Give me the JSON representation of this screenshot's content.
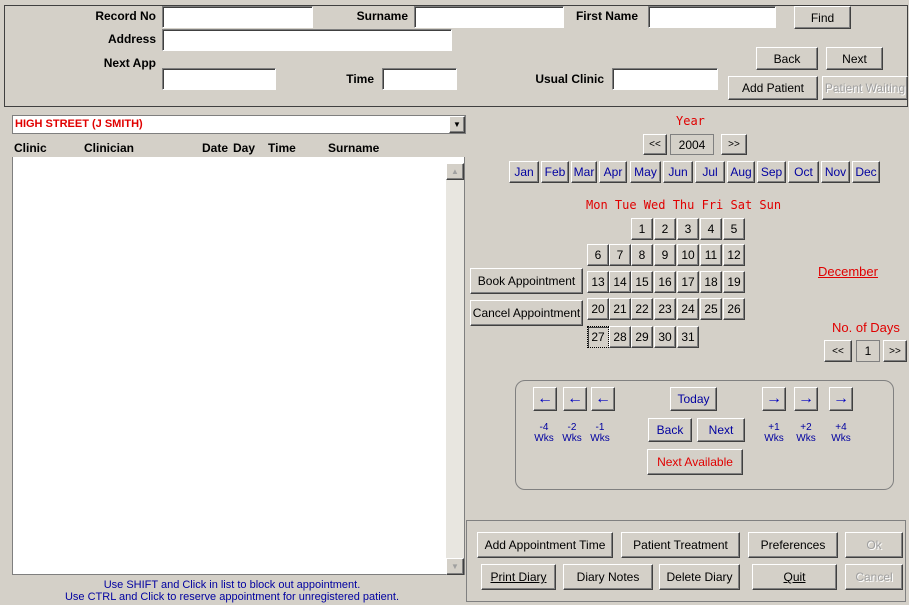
{
  "search": {
    "record_no_label": "Record No",
    "surname_label": "Surname",
    "first_name_label": "First Name",
    "address_label": "Address",
    "next_app_label": "Next App",
    "time_label": "Time",
    "usual_clinic_label": "Usual Clinic",
    "record_no_value": "",
    "surname_value": "",
    "first_name_value": "",
    "address_value": "",
    "next_app_value": "",
    "time_value": "",
    "usual_clinic_value": ""
  },
  "top_buttons": {
    "find": "Find",
    "back": "Back",
    "next": "Next",
    "add_patient": "Add Patient",
    "patient_waiting": "Patient Waiting"
  },
  "clinic": {
    "selected": "HIGH STREET (J SMITH)",
    "columns": [
      "Clinic",
      "Clinician",
      "Date",
      "Day",
      "Time",
      "Surname"
    ]
  },
  "hints": {
    "line1": "Use SHIFT and Click in list to block out appointment.",
    "line2": "Use CTRL and Click to reserve appointment for unregistered patient."
  },
  "calendar": {
    "year_label": "Year",
    "year": "2004",
    "prev_year": "<<",
    "next_year": ">>",
    "months": [
      "Jan",
      "Feb",
      "Mar",
      "Apr",
      "May",
      "Jun",
      "Jul",
      "Aug",
      "Sep",
      "Oct",
      "Nov",
      "Dec"
    ],
    "weekday_header": "Mon Tue Wed Thu Fri Sat Sun",
    "month_name": "December",
    "weeks": [
      [
        "",
        "",
        "1",
        "2",
        "3",
        "4",
        "5"
      ],
      [
        "6",
        "7",
        "8",
        "9",
        "10",
        "11",
        "12"
      ],
      [
        "13",
        "14",
        "15",
        "16",
        "17",
        "18",
        "19"
      ],
      [
        "20",
        "21",
        "22",
        "23",
        "24",
        "25",
        "26"
      ],
      [
        "27",
        "28",
        "29",
        "30",
        "31",
        "",
        ""
      ]
    ],
    "selected_day": "27",
    "no_of_days_label": "No. of Days",
    "no_of_days": "1",
    "days_prev": "<<",
    "days_next": ">>"
  },
  "appointment_buttons": {
    "book": "Book Appointment",
    "cancel": "Cancel Appointment"
  },
  "nav": {
    "arrow_left": "←",
    "arrow_right": "→",
    "minus_labels": [
      "-4",
      "-2",
      "-1"
    ],
    "plus_labels": [
      "+1",
      "+2",
      "+4"
    ],
    "wks": "Wks",
    "today": "Today",
    "back": "Back",
    "next": "Next",
    "next_available": "Next Available"
  },
  "bottom_buttons": {
    "add_appointment_time": "Add Appointment Time",
    "patient_treatment": "Patient Treatment",
    "preferences": "Preferences",
    "ok": "Ok",
    "print_diary": "Print Diary",
    "diary_notes": "Diary Notes",
    "delete_diary": "Delete Diary",
    "quit": "Quit",
    "cancel": "Cancel"
  }
}
